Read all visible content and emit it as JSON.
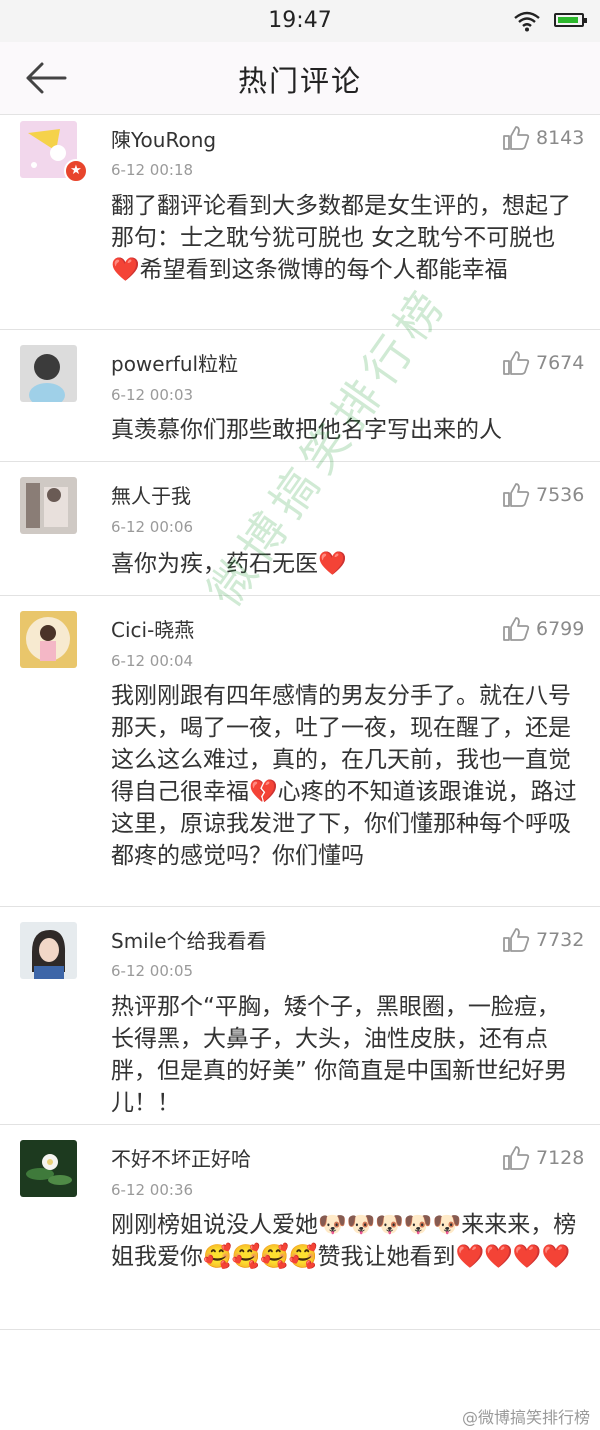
{
  "status_bar": {
    "time": "19:47"
  },
  "header": {
    "title": "热门评论"
  },
  "comments": [
    {
      "username": "陳YouRong",
      "time": "6-12 00:18",
      "likes": "8143",
      "text": "翻了翻评论看到大多数都是女生评的，想起了那句：士之耽兮犹可脱也  女之耽兮不可脱也❤️希望看到这条微博的每个人都能幸福"
    },
    {
      "username": "powerful粒粒",
      "time": "6-12 00:03",
      "likes": "7674",
      "text": "真羡慕你们那些敢把他名字写出来的人"
    },
    {
      "username": "無人于我",
      "time": "6-12 00:06",
      "likes": "7536",
      "text": "喜你为疾，药石无医❤️"
    },
    {
      "username": "Cici-晓燕",
      "time": "6-12 00:04",
      "likes": "6799",
      "text": "我刚刚跟有四年感情的男友分手了。就在八号那天，喝了一夜，吐了一夜，现在醒了，还是这么这么难过，真的，在几天前，我也一直觉得自己很幸福💔心疼的不知道该跟谁说，路过这里，原谅我发泄了下，你们懂那种每个呼吸都疼的感觉吗？你们懂吗"
    },
    {
      "username": "Smile个给我看看",
      "time": "6-12 00:05",
      "likes": "7732",
      "text": "热评那个“平胸，矮个子，黑眼圈，一脸痘，长得黑，大鼻子，大头，油性皮肤，还有点胖，但是真的好美” 你简直是中国新世纪好男儿！！"
    },
    {
      "username": "不好不坏正好哈",
      "time": "6-12 00:36",
      "likes": "7128",
      "text": "刚刚榜姐说没人爱她🐶🐶🐶🐶🐶来来来，榜姐我爱你🥰🥰🥰🥰赞我让她看到❤️❤️❤️❤️"
    }
  ],
  "watermark": {
    "center": "微博搞笑排行榜",
    "footer": "@微博搞笑排行榜"
  },
  "colors": {
    "like_icon": "#9a9a9a",
    "vip_badge": "#e8452c",
    "heart": "#e8202a"
  }
}
